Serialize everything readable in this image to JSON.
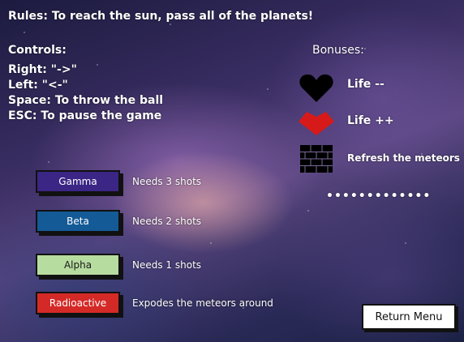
{
  "rules": "Rules:  To reach the sun, pass all of the planets!",
  "controls": {
    "title": "Controls:",
    "items": [
      "Right: \"->\"",
      "Left: \"<-\"",
      "Space: To throw the ball",
      "ESC: To pause the game"
    ]
  },
  "bonuses": {
    "title": "Bonuses:",
    "items": [
      {
        "icon": "black-heart-icon",
        "label": "Life --",
        "color": "#000000"
      },
      {
        "icon": "red-heart-icon",
        "label": "Life ++",
        "color": "#d61a1a"
      },
      {
        "icon": "brick-wall-icon",
        "label": "Refresh the meteors",
        "color": "#000000"
      }
    ],
    "dots": "•••••••••••••"
  },
  "balls": [
    {
      "label": "Gamma",
      "desc": "Needs 3 shots",
      "color": "#3b2585",
      "text_color": "#ffffff"
    },
    {
      "label": "Beta",
      "desc": "Needs 2 shots",
      "color": "#145a96",
      "text_color": "#ffffff"
    },
    {
      "label": "Alpha",
      "desc": "Needs 1 shots",
      "color": "#b7dca0",
      "text_color": "#1a1a1a"
    },
    {
      "label": "Radioactive",
      "desc": "Expodes the meteors around",
      "color": "#d42a27",
      "text_color": "#ffffff"
    }
  ],
  "return_label": "Return Menu"
}
